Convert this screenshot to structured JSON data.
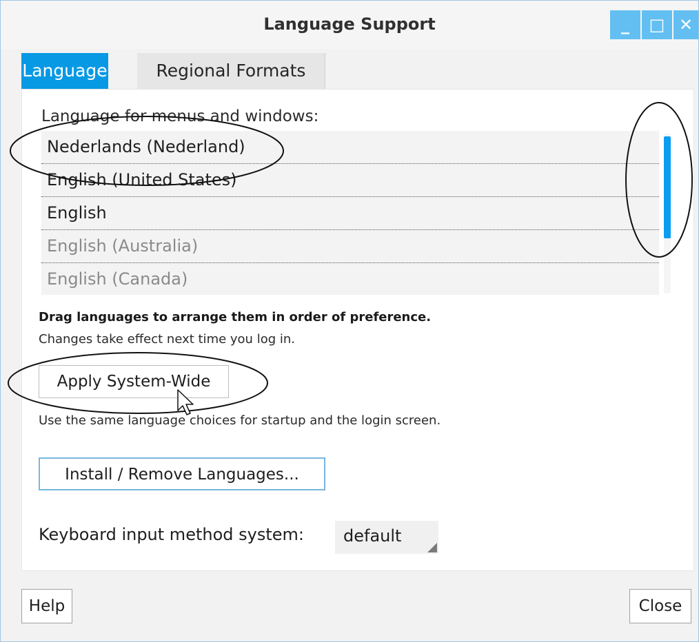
{
  "window": {
    "title": "Language Support",
    "controls": {
      "minimize": "_",
      "maximize": "□",
      "close": "✕"
    }
  },
  "tabs": [
    {
      "label": "Language",
      "active": true
    },
    {
      "label": "Regional Formats",
      "active": false
    }
  ],
  "language_tab": {
    "heading": "Language for menus and windows:",
    "languages": [
      {
        "label": "Nederlands (Nederland)",
        "enabled": true
      },
      {
        "label": "English (United States)",
        "enabled": true
      },
      {
        "label": "English",
        "enabled": true
      },
      {
        "label": "English (Australia)",
        "enabled": false
      },
      {
        "label": "English (Canada)",
        "enabled": false
      }
    ],
    "drag_hint": "Drag languages to arrange them in order of preference.",
    "effect_note": "Changes take effect next time you log in.",
    "apply_button": "Apply System-Wide",
    "apply_description": "Use the same language choices for startup and the login screen.",
    "install_button": "Install / Remove Languages...",
    "keyboard_label": "Keyboard input method system:",
    "keyboard_value": "default"
  },
  "footer": {
    "help_button": "Help",
    "close_button": "Close"
  },
  "colors": {
    "accent": "#0799e4",
    "window_controls": "#63bff1",
    "scrollbar": "#0a9df1"
  }
}
